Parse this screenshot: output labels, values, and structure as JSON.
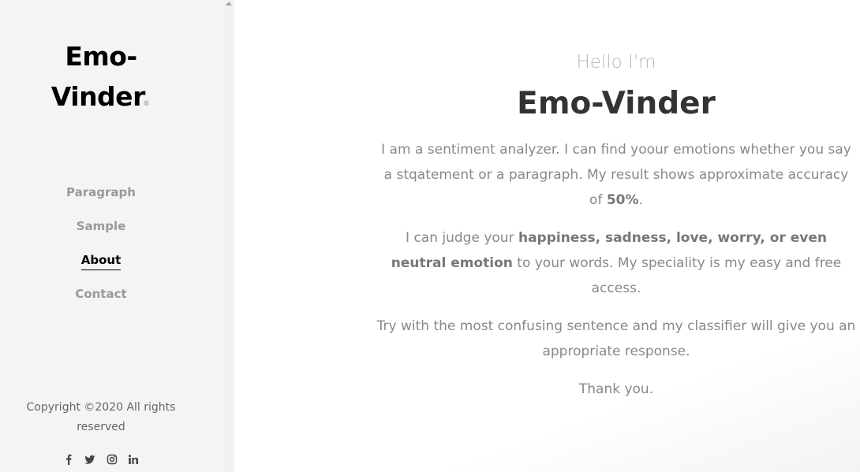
{
  "sidebar": {
    "logo_line1": "Emo-",
    "logo_line2": "Vinder",
    "logo_dot": ".",
    "nav": [
      {
        "label": "Paragraph"
      },
      {
        "label": "Sample"
      },
      {
        "label": "About",
        "active": true
      },
      {
        "label": "Contact"
      }
    ],
    "copyright_line1": "Copyright ©2020 All rights",
    "copyright_line2": "reserved",
    "social_icons": [
      "facebook-icon",
      "twitter-icon",
      "instagram-icon",
      "linkedin-icon"
    ]
  },
  "main": {
    "greeting": "Hello I'm",
    "title": "Emo-Vinder",
    "p1_text": "I am a sentiment analyzer. I can find yoour emotions whether you say a stqatement or a paragraph. My result shows approximate accuracy of ",
    "p1_bold": "50%",
    "p1_end": ".",
    "p2_start": "I can judge your ",
    "p2_bold": "happiness, sadness, love, worry, or even neutral emotion",
    "p2_end": " to your words. My speciality is my easy and free access.",
    "p3": "Try with the most confusing sentence and my classifier will give you an appropriate response.",
    "p4": "Thank you."
  },
  "colors": {
    "sidebar_bg": "#f4f4f4",
    "nav_inactive": "#999999",
    "nav_active": "#000000",
    "greeting": "#b8b8b8",
    "title": "#333333",
    "body_text": "#888888"
  }
}
